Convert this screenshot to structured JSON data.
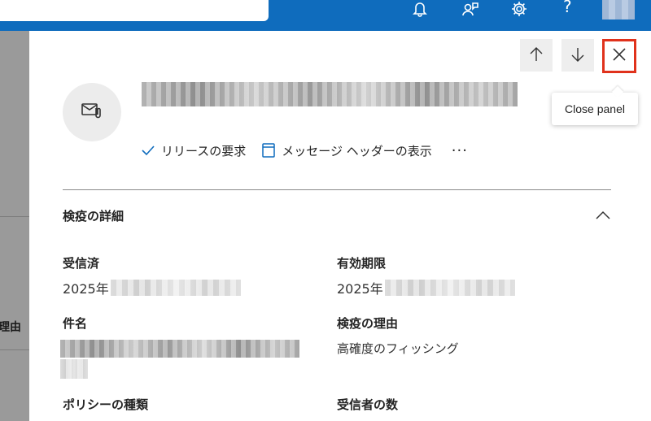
{
  "topbar": {
    "icons": [
      "bell-icon",
      "people-chat-icon",
      "gear-icon",
      "help-icon"
    ],
    "help_glyph": "?",
    "accent": "#0f6cbd"
  },
  "background_page": {
    "partial_text": "理由"
  },
  "panel": {
    "nav": {
      "up_icon": "arrow-up-icon",
      "down_icon": "arrow-down-icon",
      "close_icon": "close-icon"
    },
    "tooltip": "Close panel",
    "header_icon": "mail-attachment-icon",
    "actions": {
      "release": "リリースの要求",
      "view_headers": "メッセージ ヘッダーの表示",
      "more": "···"
    },
    "section": {
      "title": "検疫の詳細",
      "toggle_icon": "chevron-up-icon"
    },
    "fields": {
      "received_label": "受信済",
      "received_value": "2025年",
      "expires_label": "有効期限",
      "expires_value": "2025年",
      "subject_label": "件名",
      "reason_label": "検疫の理由",
      "reason_value": "高確度のフィッシング",
      "policy_label": "ポリシーの種類",
      "recipients_label": "受信者の数"
    },
    "highlight_color": "#e0321c"
  }
}
